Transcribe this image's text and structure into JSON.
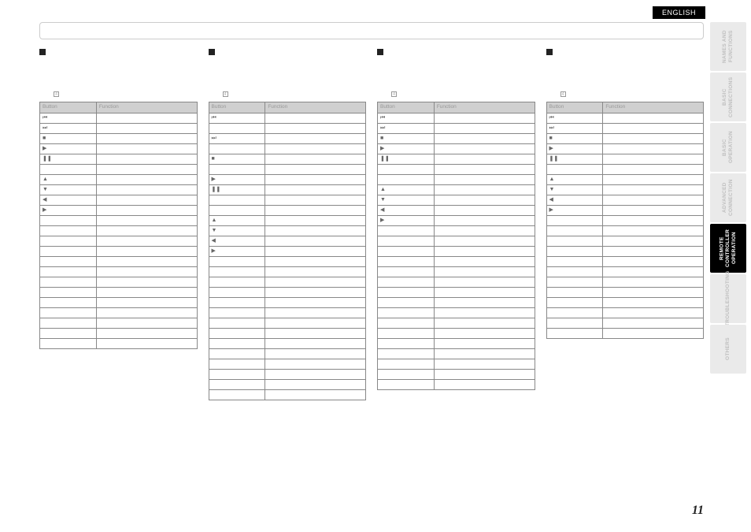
{
  "lang_badge": "ENGLISH",
  "page_number": "11",
  "side_tabs": [
    {
      "label": "NAMES AND\nFUNCTIONS",
      "active": false
    },
    {
      "label": "BASIC\nCONNECTIONS",
      "active": false
    },
    {
      "label": "BASIC\nOPERATION",
      "active": false
    },
    {
      "label": "ADVANCED\nCONNECTION",
      "active": false
    },
    {
      "label": "REMOTE CONTROLLER\nOPERATION",
      "active": true
    },
    {
      "label": "TROUBLESHOOTING",
      "active": false
    },
    {
      "label": "OTHERS",
      "active": false
    }
  ],
  "col_header_button": "Button",
  "col_header_function": "Function",
  "ref_box": "4",
  "columns": [
    {
      "title": "",
      "sub": "",
      "rows": [
        {
          "btn_sym": "⏮",
          "btn": "",
          "fn": ""
        },
        {
          "btn_sym": "⏭",
          "btn": "",
          "fn": ""
        },
        {
          "btn_sym": "■",
          "btn": "",
          "fn": ""
        },
        {
          "btn_sym": "▶",
          "btn": "",
          "fn": ""
        },
        {
          "btn_sym": "❚❚",
          "btn": "",
          "fn": ""
        },
        {
          "btn_sym": "",
          "btn": "",
          "fn": ""
        },
        {
          "btn_sym": "▲",
          "btn": "",
          "fn": ""
        },
        {
          "btn_sym": "▼",
          "btn": "",
          "fn": ""
        },
        {
          "btn_sym": "◀",
          "btn": "",
          "fn": ""
        },
        {
          "btn_sym": "▶",
          "btn": "",
          "fn": ""
        },
        {
          "btn_sym": "",
          "btn": "",
          "fn": ""
        },
        {
          "btn_sym": "",
          "btn": "",
          "fn": ""
        },
        {
          "btn_sym": "",
          "btn": "",
          "fn": ""
        },
        {
          "btn_sym": "",
          "btn": "",
          "fn": ""
        },
        {
          "btn_sym": "",
          "btn": "",
          "fn": ""
        },
        {
          "btn_sym": "",
          "btn": "",
          "fn": ""
        },
        {
          "btn_sym": "",
          "btn": "",
          "fn": ""
        },
        {
          "btn_sym": "",
          "btn": "",
          "fn": ""
        },
        {
          "btn_sym": "",
          "btn": "",
          "fn": ""
        },
        {
          "btn_sym": "",
          "btn": "",
          "fn": ""
        },
        {
          "btn_sym": "",
          "btn": "",
          "fn": ""
        },
        {
          "btn_sym": "",
          "btn": "",
          "fn": ""
        },
        {
          "btn_sym": "",
          "btn": "",
          "fn": ""
        }
      ]
    },
    {
      "title": "",
      "sub": "",
      "rows": [
        {
          "btn_sym": "⏮",
          "btn": "",
          "fn": ""
        },
        {
          "btn_sym": "",
          "btn": "",
          "fn": ""
        },
        {
          "btn_sym": "⏭",
          "btn": "",
          "fn": ""
        },
        {
          "btn_sym": "",
          "btn": "",
          "fn": ""
        },
        {
          "btn_sym": "■",
          "btn": "",
          "fn": ""
        },
        {
          "btn_sym": "",
          "btn": "",
          "fn": ""
        },
        {
          "btn_sym": "▶",
          "btn": "",
          "fn": ""
        },
        {
          "btn_sym": "❚❚",
          "btn": "",
          "fn": ""
        },
        {
          "btn_sym": "",
          "btn": "",
          "fn": ""
        },
        {
          "btn_sym": "",
          "btn": "",
          "fn": ""
        },
        {
          "btn_sym": "▲",
          "btn": "",
          "fn": ""
        },
        {
          "btn_sym": "▼",
          "btn": "",
          "fn": ""
        },
        {
          "btn_sym": "◀",
          "btn": "",
          "fn": ""
        },
        {
          "btn_sym": "▶",
          "btn": "",
          "fn": ""
        },
        {
          "btn_sym": "",
          "btn": "",
          "fn": ""
        },
        {
          "btn_sym": "",
          "btn": "",
          "fn": ""
        },
        {
          "btn_sym": "",
          "btn": "",
          "fn": ""
        },
        {
          "btn_sym": "",
          "btn": "",
          "fn": ""
        },
        {
          "btn_sym": "",
          "btn": "",
          "fn": ""
        },
        {
          "btn_sym": "",
          "btn": "",
          "fn": ""
        },
        {
          "btn_sym": "",
          "btn": "",
          "fn": ""
        },
        {
          "btn_sym": "",
          "btn": "",
          "fn": ""
        },
        {
          "btn_sym": "",
          "btn": "",
          "fn": ""
        },
        {
          "btn_sym": "",
          "btn": "",
          "fn": ""
        },
        {
          "btn_sym": "",
          "btn": "",
          "fn": ""
        },
        {
          "btn_sym": "",
          "btn": "",
          "fn": ""
        },
        {
          "btn_sym": "",
          "btn": "",
          "fn": ""
        },
        {
          "btn_sym": "",
          "btn": "",
          "fn": ""
        }
      ]
    },
    {
      "title": "",
      "sub": "",
      "rows": [
        {
          "btn_sym": "⏮",
          "btn": "",
          "fn": ""
        },
        {
          "btn_sym": "⏭",
          "btn": "",
          "fn": ""
        },
        {
          "btn_sym": "■",
          "btn": "",
          "fn": ""
        },
        {
          "btn_sym": "▶",
          "btn": "",
          "fn": ""
        },
        {
          "btn_sym": "❚❚",
          "btn": "",
          "fn": ""
        },
        {
          "btn_sym": "",
          "btn": "",
          "fn": ""
        },
        {
          "btn_sym": "",
          "btn": "",
          "fn": ""
        },
        {
          "btn_sym": "▲",
          "btn": "",
          "fn": ""
        },
        {
          "btn_sym": "▼",
          "btn": "",
          "fn": ""
        },
        {
          "btn_sym": "◀",
          "btn": "",
          "fn": ""
        },
        {
          "btn_sym": "▶",
          "btn": "",
          "fn": ""
        },
        {
          "btn_sym": "",
          "btn": "",
          "fn": ""
        },
        {
          "btn_sym": "",
          "btn": "",
          "fn": ""
        },
        {
          "btn_sym": "",
          "btn": "",
          "fn": ""
        },
        {
          "btn_sym": "",
          "btn": "",
          "fn": ""
        },
        {
          "btn_sym": "",
          "btn": "",
          "fn": ""
        },
        {
          "btn_sym": "",
          "btn": "",
          "fn": ""
        },
        {
          "btn_sym": "",
          "btn": "",
          "fn": ""
        },
        {
          "btn_sym": "",
          "btn": "",
          "fn": ""
        },
        {
          "btn_sym": "",
          "btn": "",
          "fn": ""
        },
        {
          "btn_sym": "",
          "btn": "",
          "fn": ""
        },
        {
          "btn_sym": "",
          "btn": "",
          "fn": ""
        },
        {
          "btn_sym": "",
          "btn": "",
          "fn": ""
        },
        {
          "btn_sym": "",
          "btn": "",
          "fn": ""
        },
        {
          "btn_sym": "",
          "btn": "",
          "fn": ""
        },
        {
          "btn_sym": "",
          "btn": "",
          "fn": ""
        },
        {
          "btn_sym": "",
          "btn": "",
          "fn": ""
        }
      ]
    },
    {
      "title": "",
      "sub": "",
      "rows": [
        {
          "btn_sym": "⏮",
          "btn": "",
          "fn": ""
        },
        {
          "btn_sym": "⏭",
          "btn": "",
          "fn": ""
        },
        {
          "btn_sym": "■",
          "btn": "",
          "fn": ""
        },
        {
          "btn_sym": "▶",
          "btn": "",
          "fn": ""
        },
        {
          "btn_sym": "❚❚",
          "btn": "",
          "fn": ""
        },
        {
          "btn_sym": "",
          "btn": "",
          "fn": ""
        },
        {
          "btn_sym": "▲",
          "btn": "",
          "fn": ""
        },
        {
          "btn_sym": "▼",
          "btn": "",
          "fn": ""
        },
        {
          "btn_sym": "◀",
          "btn": "",
          "fn": ""
        },
        {
          "btn_sym": "▶",
          "btn": "",
          "fn": ""
        },
        {
          "btn_sym": "",
          "btn": "",
          "fn": ""
        },
        {
          "btn_sym": "",
          "btn": "",
          "fn": ""
        },
        {
          "btn_sym": "",
          "btn": "",
          "fn": ""
        },
        {
          "btn_sym": "",
          "btn": "",
          "fn": ""
        },
        {
          "btn_sym": "",
          "btn": "",
          "fn": ""
        },
        {
          "btn_sym": "",
          "btn": "",
          "fn": ""
        },
        {
          "btn_sym": "",
          "btn": "",
          "fn": ""
        },
        {
          "btn_sym": "",
          "btn": "",
          "fn": ""
        },
        {
          "btn_sym": "",
          "btn": "",
          "fn": ""
        },
        {
          "btn_sym": "",
          "btn": "",
          "fn": ""
        },
        {
          "btn_sym": "",
          "btn": "",
          "fn": ""
        },
        {
          "btn_sym": "",
          "btn": "",
          "fn": ""
        }
      ]
    }
  ]
}
